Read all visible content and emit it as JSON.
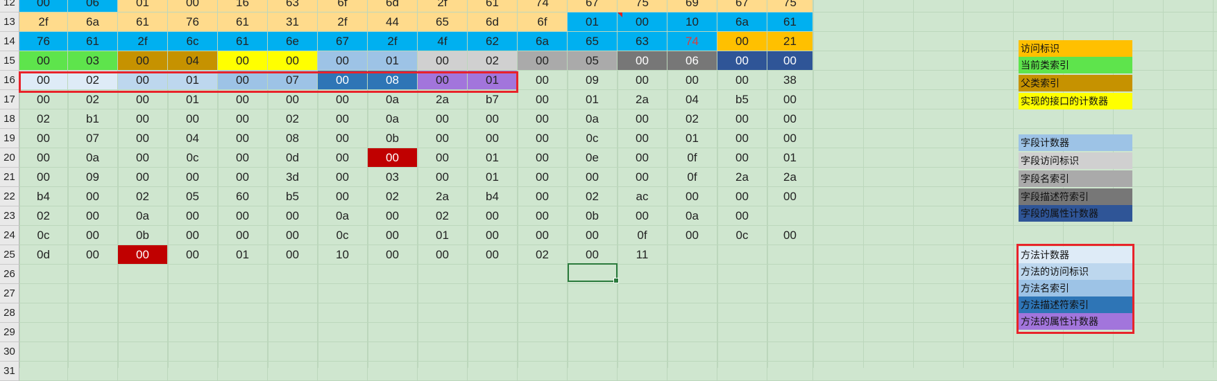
{
  "rows": [
    {
      "num": "12",
      "cells": [
        "00",
        "06",
        "01",
        "00",
        "16",
        "63",
        "6f",
        "6d",
        "2f",
        "61",
        "74",
        "67",
        "75",
        "69",
        "67",
        "75"
      ]
    },
    {
      "num": "13",
      "cells": [
        "2f",
        "6a",
        "61",
        "76",
        "61",
        "31",
        "2f",
        "44",
        "65",
        "6d",
        "6f",
        "01",
        "00",
        "10",
        "6a",
        "61"
      ]
    },
    {
      "num": "14",
      "cells": [
        "76",
        "61",
        "2f",
        "6c",
        "61",
        "6e",
        "67",
        "2f",
        "4f",
        "62",
        "6a",
        "65",
        "63",
        "74",
        "00",
        "21"
      ]
    },
    {
      "num": "15",
      "cells": [
        "00",
        "03",
        "00",
        "04",
        "00",
        "00",
        "00",
        "01",
        "00",
        "02",
        "00",
        "05",
        "00",
        "06",
        "00",
        "00"
      ]
    },
    {
      "num": "16",
      "cells": [
        "00",
        "02",
        "00",
        "01",
        "00",
        "07",
        "00",
        "08",
        "00",
        "01",
        "00",
        "09",
        "00",
        "00",
        "00",
        "38"
      ]
    },
    {
      "num": "17",
      "cells": [
        "00",
        "02",
        "00",
        "01",
        "00",
        "00",
        "00",
        "0a",
        "2a",
        "b7",
        "00",
        "01",
        "2a",
        "04",
        "b5",
        "00"
      ]
    },
    {
      "num": "18",
      "cells": [
        "02",
        "b1",
        "00",
        "00",
        "00",
        "02",
        "00",
        "0a",
        "00",
        "00",
        "00",
        "0a",
        "00",
        "02",
        "00",
        "00"
      ]
    },
    {
      "num": "19",
      "cells": [
        "00",
        "07",
        "00",
        "04",
        "00",
        "08",
        "00",
        "0b",
        "00",
        "00",
        "00",
        "0c",
        "00",
        "01",
        "00",
        "00"
      ]
    },
    {
      "num": "20",
      "cells": [
        "00",
        "0a",
        "00",
        "0c",
        "00",
        "0d",
        "00",
        "00",
        "00",
        "01",
        "00",
        "0e",
        "00",
        "0f",
        "00",
        "01"
      ]
    },
    {
      "num": "21",
      "cells": [
        "00",
        "09",
        "00",
        "00",
        "00",
        "3d",
        "00",
        "03",
        "00",
        "01",
        "00",
        "00",
        "00",
        "0f",
        "2a",
        "2a"
      ]
    },
    {
      "num": "22",
      "cells": [
        "b4",
        "00",
        "02",
        "05",
        "60",
        "b5",
        "00",
        "02",
        "2a",
        "b4",
        "00",
        "02",
        "ac",
        "00",
        "00",
        "00"
      ]
    },
    {
      "num": "23",
      "cells": [
        "02",
        "00",
        "0a",
        "00",
        "00",
        "00",
        "0a",
        "00",
        "02",
        "00",
        "00",
        "0b",
        "00",
        "0a",
        "00",
        ""
      ]
    },
    {
      "num": "24",
      "cells": [
        "0c",
        "00",
        "0b",
        "00",
        "00",
        "00",
        "0c",
        "00",
        "01",
        "00",
        "00",
        "00",
        "0f",
        "00",
        "0c",
        "00"
      ]
    },
    {
      "num": "25",
      "cells": [
        "0d",
        "00",
        "00",
        "00",
        "01",
        "00",
        "10",
        "00",
        "00",
        "00",
        "02",
        "00",
        "11",
        "",
        "",
        ""
      ]
    },
    {
      "num": "26",
      "cells": [
        "",
        "",
        "",
        "",
        "",
        "",
        "",
        "",
        "",
        "",
        "",
        "",
        "",
        "",
        "",
        ""
      ]
    },
    {
      "num": "27",
      "cells": [
        "",
        "",
        "",
        "",
        "",
        "",
        "",
        "",
        "",
        "",
        "",
        "",
        "",
        "",
        "",
        ""
      ]
    },
    {
      "num": "28",
      "cells": [
        "",
        "",
        "",
        "",
        "",
        "",
        "",
        "",
        "",
        "",
        "",
        "",
        "",
        "",
        "",
        ""
      ]
    },
    {
      "num": "29",
      "cells": [
        "",
        "",
        "",
        "",
        "",
        "",
        "",
        "",
        "",
        "",
        "",
        "",
        "",
        "",
        "",
        ""
      ]
    },
    {
      "num": "30",
      "cells": [
        "",
        "",
        "",
        "",
        "",
        "",
        "",
        "",
        "",
        "",
        "",
        "",
        "",
        "",
        "",
        ""
      ]
    },
    {
      "num": "31",
      "cells": [
        "",
        "",
        "",
        "",
        "",
        "",
        "",
        "",
        "",
        "",
        "",
        "",
        "",
        "",
        "",
        ""
      ]
    }
  ],
  "legend": [
    {
      "label": "访问标识",
      "color": "#ffc000"
    },
    {
      "label": "当前类索引",
      "color": "#5ee44c"
    },
    {
      "label": "父类索引",
      "color": "#c69200"
    },
    {
      "label": "实现的接口的计数器",
      "color": "#ffff00"
    },
    {
      "label": "字段计数器",
      "color": "#9dc3e6"
    },
    {
      "label": "字段访问标识",
      "color": "#d0d0d0"
    },
    {
      "label": "字段名索引",
      "color": "#aaaaaa"
    },
    {
      "label": "字段描述符索引",
      "color": "#777777"
    },
    {
      "label": "字段的属性计数器",
      "color": "#2f5597"
    },
    {
      "label": "方法计数器",
      "color": "#deebf7"
    },
    {
      "label": "方法的访问标识",
      "color": "#bdd7ee"
    },
    {
      "label": "方法名索引",
      "color": "#9dc3e6"
    },
    {
      "label": "方法描述符索引",
      "color": "#2e75b6"
    },
    {
      "label": "方法的属性计数器",
      "color": "#a275dc"
    }
  ],
  "colors": {
    "sheet_bg": "#cfe6cf",
    "constant_pool_light": "#ffdb8c",
    "constant_pool_blue": "#00b0f0",
    "highlight_red": "#c00000",
    "selection_green": "#2a7a3c",
    "outline_red": "#e8232a",
    "red_text": "#e03a3a"
  }
}
